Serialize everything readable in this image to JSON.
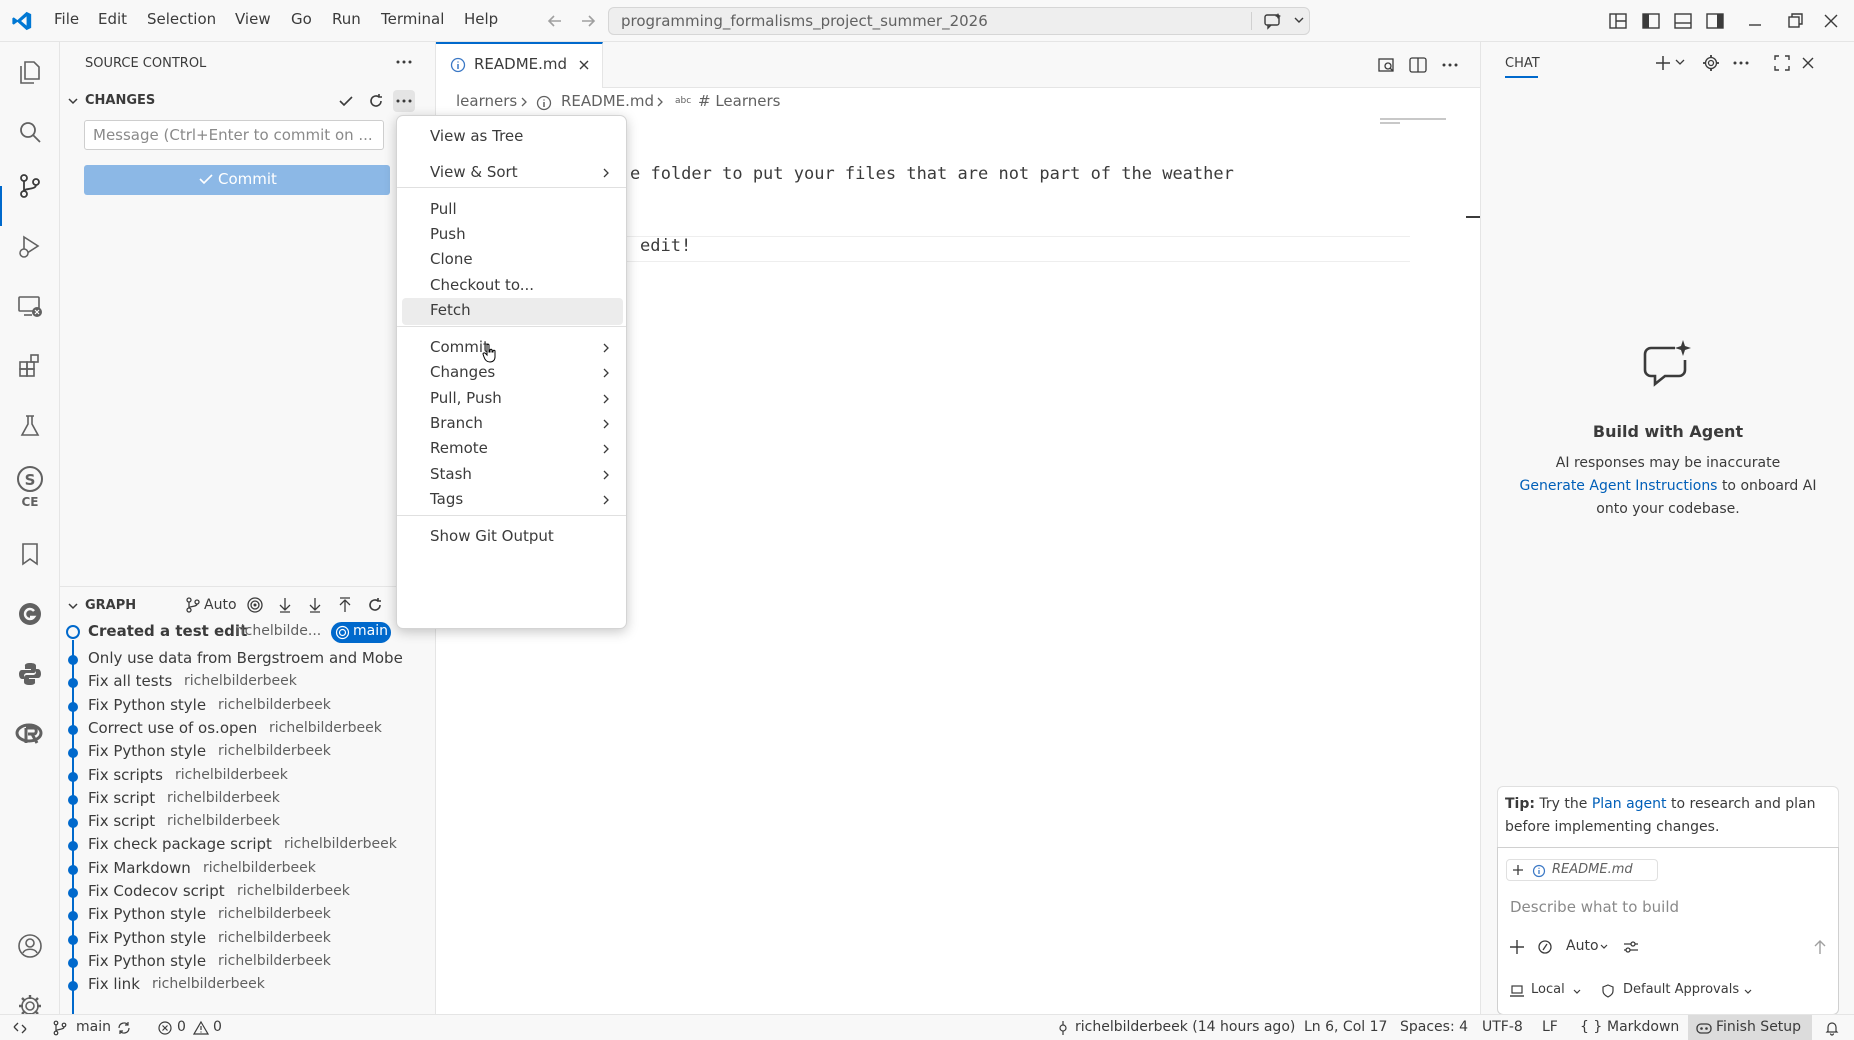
{
  "menubar": {
    "items": [
      "File",
      "Edit",
      "Selection",
      "View",
      "Go",
      "Run",
      "Terminal",
      "Help"
    ],
    "search_text": "programming_formalisms_project_summer_2026"
  },
  "sidebar": {
    "title": "SOURCE CONTROL",
    "changes_title": "CHANGES",
    "commit_placeholder": "Message (Ctrl+Enter to commit on ...",
    "commit_label": "Commit",
    "graph_title": "GRAPH",
    "graph_auto": "Auto",
    "graph_head": {
      "message": "Created a test edit",
      "author": "richelbilde...",
      "branch": "main"
    },
    "graph_commits": [
      {
        "message": "Only use data from Bergstroem and Mobe",
        "author": ""
      },
      {
        "message": "Fix all tests",
        "author": "richelbilderbeek"
      },
      {
        "message": "Fix Python style",
        "author": "richelbilderbeek"
      },
      {
        "message": "Correct use of os.open",
        "author": "richelbilderbeek"
      },
      {
        "message": "Fix Python style",
        "author": "richelbilderbeek"
      },
      {
        "message": "Fix scripts",
        "author": "richelbilderbeek"
      },
      {
        "message": "Fix script",
        "author": "richelbilderbeek"
      },
      {
        "message": "Fix script",
        "author": "richelbilderbeek"
      },
      {
        "message": "Fix check package script",
        "author": "richelbilderbeek"
      },
      {
        "message": "Fix Markdown",
        "author": "richelbilderbeek"
      },
      {
        "message": "Fix Codecov script",
        "author": "richelbilderbeek"
      },
      {
        "message": "Fix Python style",
        "author": "richelbilderbeek"
      },
      {
        "message": "Fix Python style",
        "author": "richelbilderbeek"
      },
      {
        "message": "Fix Python style",
        "author": "richelbilderbeek"
      },
      {
        "message": "Fix link",
        "author": "richelbilderbeek"
      }
    ]
  },
  "editor": {
    "tab_label": "README.md",
    "breadcrumb": {
      "folder": "learners",
      "file": "README.md",
      "symbol": "# Learners",
      "symbol_prefix": "abc"
    },
    "code_lines": {
      "line1": "e folder to put your files that are not part of the weather",
      "line2": "edit!"
    }
  },
  "context_menu": {
    "group1": [
      {
        "label": "View as Tree",
        "submenu": false
      },
      {
        "label": "View & Sort",
        "submenu": true
      }
    ],
    "group2": [
      {
        "label": "Pull",
        "submenu": false
      },
      {
        "label": "Push",
        "submenu": false
      },
      {
        "label": "Clone",
        "submenu": false
      },
      {
        "label": "Checkout to...",
        "submenu": false
      },
      {
        "label": "Fetch",
        "submenu": false
      }
    ],
    "group3": [
      {
        "label": "Commit",
        "submenu": true
      },
      {
        "label": "Changes",
        "submenu": true
      },
      {
        "label": "Pull, Push",
        "submenu": true
      },
      {
        "label": "Branch",
        "submenu": true
      },
      {
        "label": "Remote",
        "submenu": true
      },
      {
        "label": "Stash",
        "submenu": true
      },
      {
        "label": "Tags",
        "submenu": true
      }
    ],
    "group4": [
      {
        "label": "Show Git Output",
        "submenu": false
      }
    ],
    "highlighted": "Fetch"
  },
  "chat": {
    "tab_label": "CHAT",
    "heading": "Build with Agent",
    "disclaimer": "AI responses may be inaccurate",
    "instructions_link": "Generate Agent Instructions",
    "instructions_rest": "to onboard AI",
    "instructions_rest2": "onto your codebase.",
    "tip_label": "Tip:",
    "tip_pre": "Try the",
    "tip_link": "Plan agent",
    "tip_post": "to research and plan",
    "tip_post2": "before implementing changes.",
    "attachment": "README.md",
    "input_placeholder": "Describe what to build",
    "mode": "Auto",
    "location": "Local",
    "approvals": "Default Approvals"
  },
  "statusbar": {
    "branch": "main",
    "errors": "0",
    "warnings": "0",
    "blame": "richelbilderbeek (14 hours ago)",
    "cursor": "Ln 6, Col 17",
    "spaces": "Spaces: 4",
    "encoding": "UTF-8",
    "eol": "LF",
    "language": "Markdown",
    "finish_setup": "Finish Setup"
  },
  "colors": {
    "accent": "#0069cc",
    "commit_button": "#8cb8e6",
    "branch_badge": "#0069cc"
  }
}
